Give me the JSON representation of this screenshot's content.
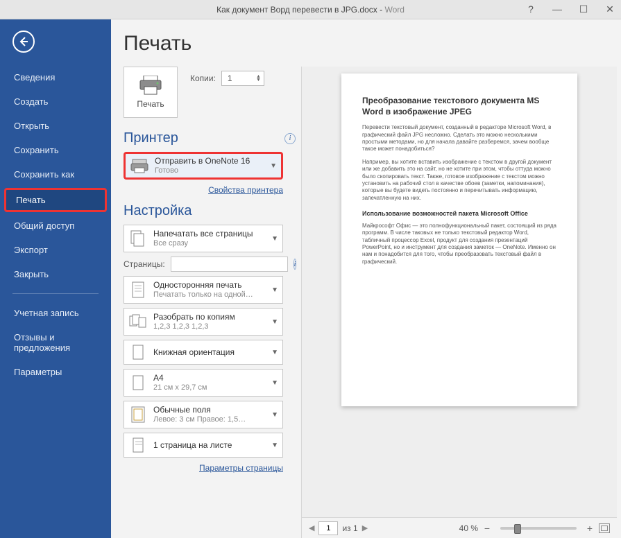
{
  "window": {
    "doc_title": "Как документ Ворд перевести в JPG.docx",
    "app": "Word",
    "help": "?",
    "min": "—",
    "max": "☐",
    "close": "✕"
  },
  "sidebar": {
    "items": [
      {
        "label": "Сведения",
        "active": false
      },
      {
        "label": "Создать",
        "active": false
      },
      {
        "label": "Открыть",
        "active": false
      },
      {
        "label": "Сохранить",
        "active": false
      },
      {
        "label": "Сохранить как",
        "active": false
      },
      {
        "label": "Печать",
        "active": true
      },
      {
        "label": "Общий доступ",
        "active": false
      },
      {
        "label": "Экспорт",
        "active": false
      },
      {
        "label": "Закрыть",
        "active": false
      }
    ],
    "footer": [
      {
        "label": "Учетная запись"
      },
      {
        "label": "Отзывы и предложения"
      },
      {
        "label": "Параметры"
      }
    ]
  },
  "page_title": "Печать",
  "print": {
    "button_label": "Печать",
    "copies_label": "Копии:",
    "copies_value": "1"
  },
  "printer": {
    "heading": "Принтер",
    "name": "Отправить в OneNote 16",
    "status": "Готово",
    "properties_link": "Свойства принтера"
  },
  "settings": {
    "heading": "Настройка",
    "print_all": {
      "title": "Напечатать все страницы",
      "sub": "Все сразу"
    },
    "pages_label": "Страницы:",
    "pages_value": "",
    "one_sided": {
      "title": "Односторонняя печать",
      "sub": "Печатать только на одной…"
    },
    "collate": {
      "title": "Разобрать по копиям",
      "sub": "1,2,3    1,2,3    1,2,3"
    },
    "orientation": {
      "title": "Книжная ориентация",
      "sub": ""
    },
    "paper": {
      "title": "A4",
      "sub": "21 см x 29,7 см"
    },
    "margins": {
      "title": "Обычные поля",
      "sub": "Левое:  3 см   Правое:  1,5…"
    },
    "per_sheet": {
      "title": "1 страница на листе",
      "sub": ""
    },
    "page_setup_link": "Параметры страницы"
  },
  "preview": {
    "doc": {
      "h1": "Преобразование текстового документа MS Word в изображение JPEG",
      "p1": "Перевести текстовый документ, созданный в редакторе Microsoft Word, в графический файл JPG несложно. Сделать это можно несколькими простыми методами, но для начала давайте разберемся, зачем вообще такое может понадобиться?",
      "p2": "Например, вы хотите вставить изображение с текстом в другой документ или же добавить это на сайт, но не хотите при этом, чтобы оттуда можно было скопировать текст. Также, готовое изображение с текстом можно установить на рабочий стол в качестве обоев (заметки, напоминания), которые вы будете видеть постоянно и перечитывать информацию, запечатленную на них.",
      "h2": "Использование возможностей пакета Microsoft Office",
      "p3": "Майкрософт Офис — это полнофункциональный пакет, состоящий из ряда программ. В числе таковых не только текстовый редактор Word, табличный процессор Excel, продукт для создания презентаций PowerPoint, но и инструмент для создания заметок — OneNote. Именно он нам и понадобится для того, чтобы преобразовать текстовый файл в графический."
    },
    "footer": {
      "page_value": "1",
      "of_label": "из 1",
      "zoom_label": "40 %"
    }
  }
}
